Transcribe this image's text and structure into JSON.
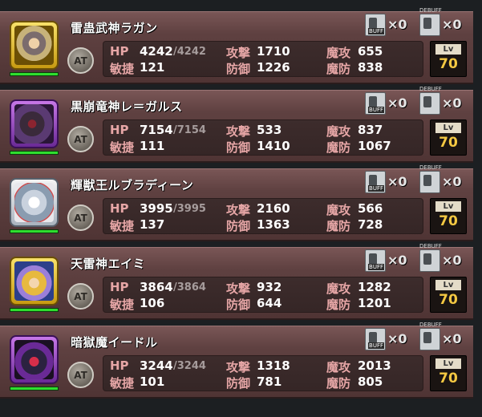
{
  "labels": {
    "hp": "HP",
    "attack": "攻撃",
    "magic_attack": "魔攻",
    "agility": "敏捷",
    "defense": "防御",
    "magic_defense": "魔防",
    "at": "AT",
    "lv": "Lv",
    "buff_tag": "BUFF",
    "debuff_tag": "DEBUFF"
  },
  "units": [
    {
      "name": "雷蛊武神ラガン",
      "hp": "4242",
      "max_hp": "/4242",
      "attack": "1710",
      "magic_attack": "655",
      "agility": "121",
      "defense": "1226",
      "magic_defense": "838",
      "buff_count": "×0",
      "debuff_count": "×0",
      "level": "70",
      "hp_fill": 1.0,
      "frame_color": "yellow"
    },
    {
      "name": "黒崩竜神レ＝ガルス",
      "hp": "7154",
      "max_hp": "/7154",
      "attack": "533",
      "magic_attack": "837",
      "agility": "111",
      "defense": "1410",
      "magic_defense": "1067",
      "buff_count": "×0",
      "debuff_count": "×0",
      "level": "70",
      "hp_fill": 1.0,
      "frame_color": "purple"
    },
    {
      "name": "輝獣王ルブラディーン",
      "hp": "3995",
      "max_hp": "/3995",
      "attack": "2160",
      "magic_attack": "566",
      "agility": "137",
      "defense": "1363",
      "magic_defense": "728",
      "buff_count": "×0",
      "debuff_count": "×0",
      "level": "70",
      "hp_fill": 1.0,
      "frame_color": "white"
    },
    {
      "name": "天雷神エイミ",
      "hp": "3864",
      "max_hp": "/3864",
      "attack": "932",
      "magic_attack": "1282",
      "agility": "106",
      "defense": "644",
      "magic_defense": "1201",
      "buff_count": "×0",
      "debuff_count": "×0",
      "level": "70",
      "hp_fill": 1.0,
      "frame_color": "yellow"
    },
    {
      "name": "暗獄魔イードル",
      "hp": "3244",
      "max_hp": "/3244",
      "attack": "1318",
      "magic_attack": "2013",
      "agility": "101",
      "defense": "781",
      "magic_defense": "805",
      "buff_count": "×0",
      "debuff_count": "×0",
      "level": "70",
      "hp_fill": 1.0,
      "frame_color": "purple"
    }
  ]
}
